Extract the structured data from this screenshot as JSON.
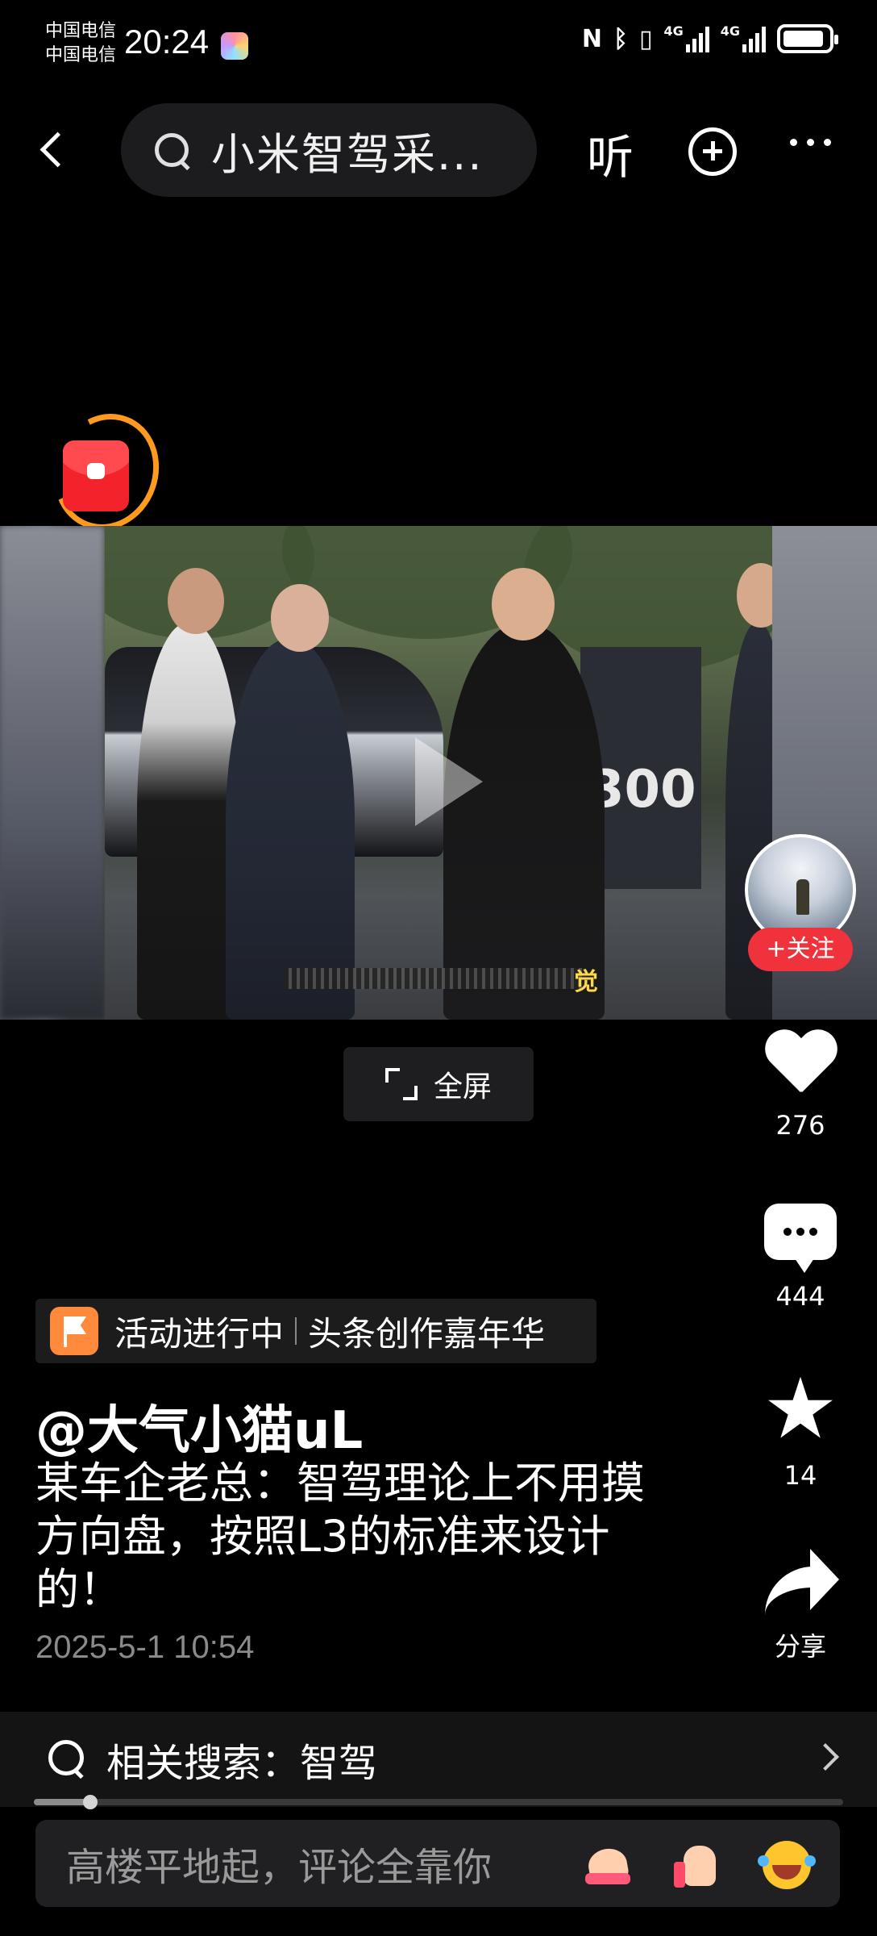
{
  "status_bar": {
    "carrier_1": "中国电信",
    "carrier_2": "中国电信",
    "time": "20:24",
    "icons": [
      "nfc-icon",
      "bluetooth-icon",
      "vibrate-icon",
      "signal-4g-icon",
      "signal-4g-icon",
      "battery-icon"
    ],
    "network_1": "4G",
    "network_2": "4G",
    "battery_level": 0.9
  },
  "nav": {
    "search_query": "小米智驾采...",
    "listen_label": "听",
    "icons": [
      "back-icon",
      "search-icon",
      "add-circle-icon",
      "more-icon"
    ]
  },
  "video": {
    "sign_text": "300",
    "caption_tail": "觉"
  },
  "author": {
    "follow_label": "+关注",
    "name": "@大气小猫uL"
  },
  "fullscreen_label": "全屏",
  "actions": {
    "likes": "276",
    "comments": "444",
    "favorites": "14",
    "share_label": "分享"
  },
  "activity": {
    "status": "活动进行中",
    "name": "头条创作嘉年华"
  },
  "post": {
    "text": "某车企老总：智驾理论上不用摸方向盘，按照L3的标准来设计的！",
    "time": "2025-5-1 10:54"
  },
  "related_search": {
    "label": "相关搜索：智驾"
  },
  "progress": 0.07,
  "comment_bar": {
    "placeholder": "高楼平地起，评论全靠你",
    "emojis": [
      "pray-emoji",
      "thumbs-up-emoji",
      "laughing-emoji"
    ]
  },
  "colors": {
    "follow": "#f0323c",
    "activity_flag": "#ff8a3c",
    "red_packet": "#f3232b",
    "red_packet_ring": "#ff9a1f"
  }
}
